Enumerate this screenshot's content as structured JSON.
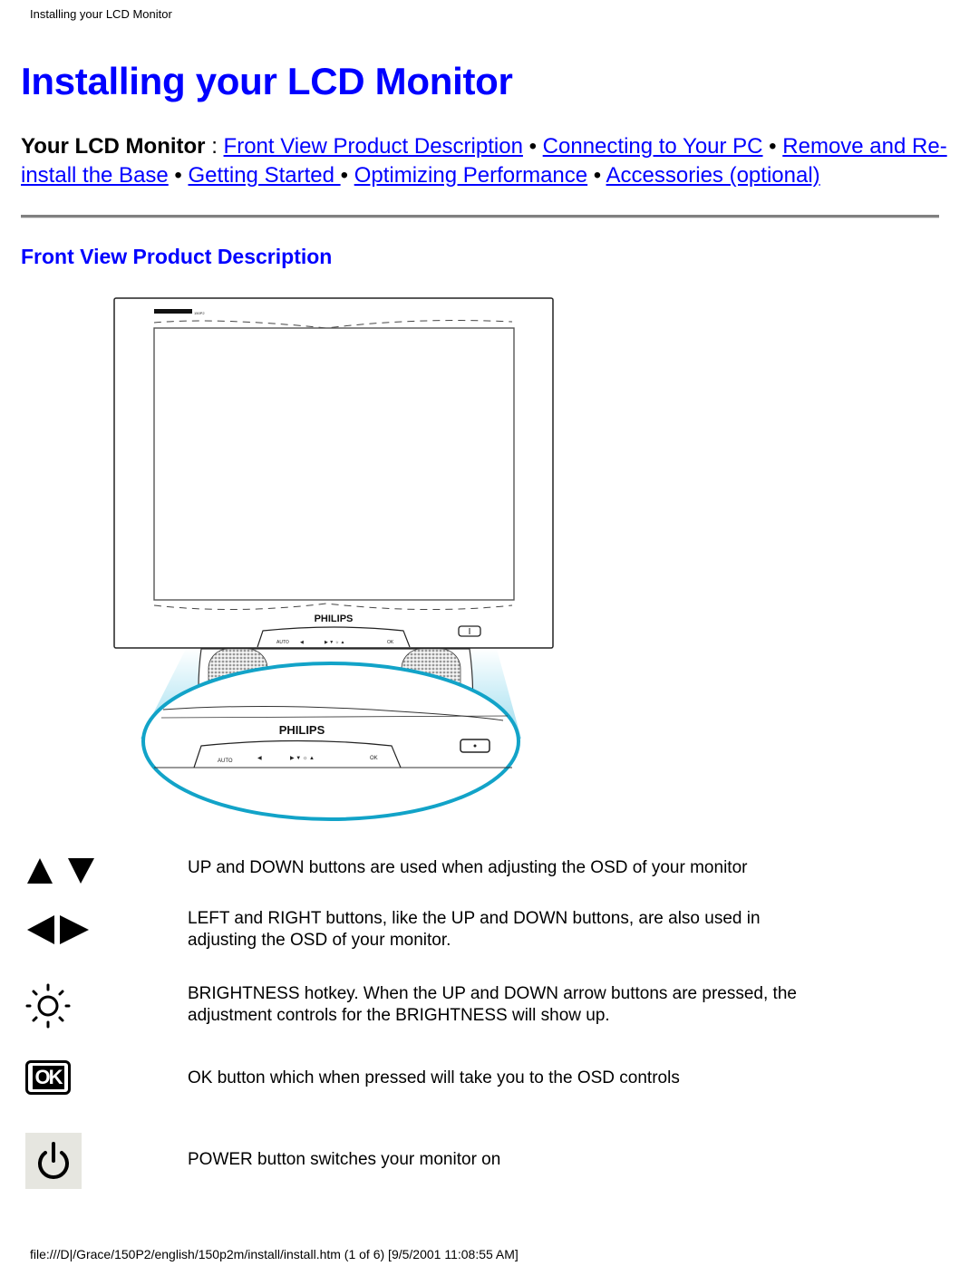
{
  "running_header": "Installing your LCD Monitor",
  "page_title": "Installing your LCD Monitor",
  "nav": {
    "lead": "Your LCD Monitor",
    "lead_sep": " : ",
    "separator": " • ",
    "links": [
      {
        "label": "Front View Product Description"
      },
      {
        "label": "Connecting to Your PC"
      },
      {
        "label": "Remove and Re-install the Base"
      },
      {
        "label": "Getting Started "
      },
      {
        "label": "Optimizing Performance"
      },
      {
        "label": "Accessories (optional)"
      }
    ]
  },
  "section": {
    "title": "Front View Product Description"
  },
  "figure": {
    "brand_label": "PHILIPS",
    "highlight_color": "#12a3c8"
  },
  "controls": [
    {
      "icon": "up-down-arrows-icon",
      "text": "UP and DOWN buttons are used when adjusting the OSD of your monitor"
    },
    {
      "icon": "left-right-arrows-icon",
      "text": "LEFT and RIGHT buttons, like the UP and DOWN buttons, are also used in adjusting the OSD of your monitor."
    },
    {
      "icon": "brightness-icon",
      "text": "BRIGHTNESS hotkey. When the UP and DOWN arrow buttons are pressed, the adjustment controls for the BRIGHTNESS will show up."
    },
    {
      "icon": "ok-icon",
      "icon_label": "OK",
      "text": "OK button which when pressed will take you to the OSD controls"
    },
    {
      "icon": "power-icon",
      "text": "POWER button switches your monitor on"
    }
  ],
  "footer": "file:///D|/Grace/150P2/english/150p2m/install/install.htm (1 of 6) [9/5/2001 11:08:55 AM]"
}
